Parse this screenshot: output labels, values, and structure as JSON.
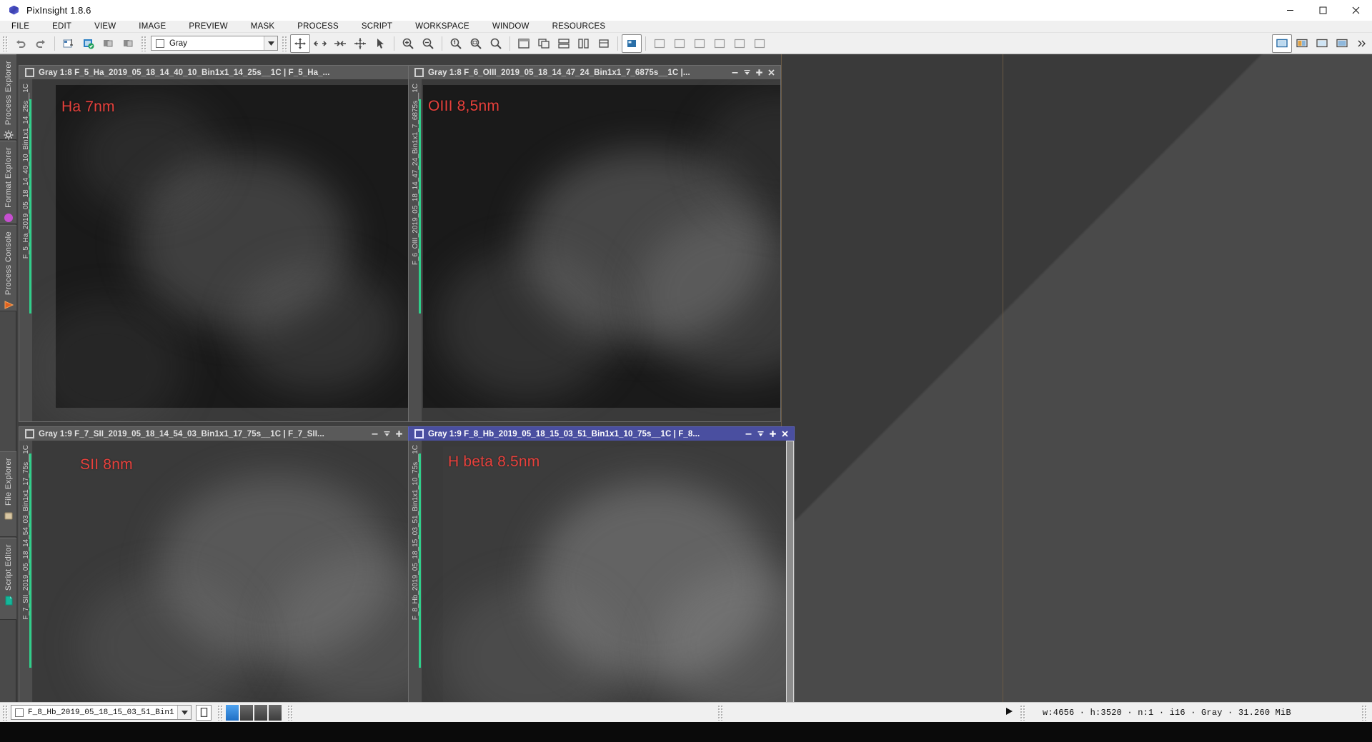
{
  "window": {
    "app_title": "PixInsight 1.8.6",
    "icon": "pixinsight-cube-icon",
    "controls": {
      "minimize": "minimize-icon",
      "maximize": "maximize-icon",
      "close": "close-icon"
    }
  },
  "menubar": {
    "items": [
      {
        "label": "FILE"
      },
      {
        "label": "EDIT"
      },
      {
        "label": "VIEW"
      },
      {
        "label": "IMAGE"
      },
      {
        "label": "PREVIEW"
      },
      {
        "label": "MASK"
      },
      {
        "label": "PROCESS"
      },
      {
        "label": "SCRIPT"
      },
      {
        "label": "WORKSPACE"
      },
      {
        "label": "WINDOW"
      },
      {
        "label": "RESOURCES"
      }
    ]
  },
  "toolbar": {
    "groups": [
      {
        "icons": [
          "undo-icon",
          "redo-icon"
        ]
      },
      {
        "icons": [
          "new-image-icon",
          "open-image-icon",
          "save-image-icon",
          "save-as-image-icon"
        ]
      }
    ],
    "color_space_combo": {
      "value": "Gray",
      "swatch": "gray-swatch-icon",
      "dropdown": "chevron-down-icon"
    },
    "nav_icons": [
      "move-icon",
      "expand-icon",
      "collapse-icon",
      "fit-icon",
      "pointer-icon"
    ],
    "zoom_icons": [
      "zoom-in-icon",
      "zoom-out-icon",
      "zoom-1to1-icon",
      "zoom-fit-icon"
    ],
    "window_icons": [
      "tile-window-icon",
      "cascade-window-icon",
      "tile-horizontal-icon",
      "tile-vertical-icon",
      "stack-window-icon"
    ],
    "readout_icons": [
      "readout-icon"
    ],
    "misc_icons": [
      "histogram-icon",
      "stf-icon",
      "mask-icon",
      "preview-icon",
      "annotate-icon",
      "grid-icon"
    ],
    "right_icons": [
      "screen-icon",
      "screen-transfer-icon",
      "monitor-icon",
      "display-icon"
    ],
    "overflow": "chevron-right-overflow-icon"
  },
  "left_dock": {
    "top_tabs": [
      {
        "label": "Process Explorer",
        "icon": "gear-icon",
        "icon_color": "#d8d8d8"
      },
      {
        "label": "Format Explorer",
        "icon": "circle-icon",
        "icon_color": "#c64fd0"
      },
      {
        "label": "Process Console",
        "icon": "triangle-play-icon",
        "icon_color": "#e0621f"
      }
    ],
    "bottom_tabs": [
      {
        "label": "File Explorer",
        "icon": "folder-icon",
        "icon_color": "#d8c7a3"
      },
      {
        "label": "Script Editor",
        "icon": "document-icon",
        "icon_color": "#15b79a"
      }
    ]
  },
  "image_windows": [
    {
      "id": "win-ha",
      "active": false,
      "title": "Gray 1:8 F_5_Ha_2019_05_18_14_40_10_Bin1x1_14_25s__1C | F_5_Ha_...",
      "side_label": "F_5_Ha_2019_05_18_14_40_10_Bin1x1_14_25s__1C",
      "overlay_label": "Ha 7nm",
      "overlay_color": "#e8413c",
      "titlebar_icon": "window-restore-icon",
      "buttons": [
        "minimize-icon",
        "shade-icon",
        "maximize-icon",
        "close-icon"
      ]
    },
    {
      "id": "win-oiii",
      "active": false,
      "title": "Gray 1:8 F_6_OIII_2019_05_18_14_47_24_Bin1x1_7_6875s__1C |...",
      "side_label": "F_6_OIII_2019_05_18_14_47_24_Bin1x1_7_6875s__1C",
      "overlay_label": "OIII 8,5nm",
      "overlay_color": "#e8413c",
      "titlebar_icon": "window-restore-icon",
      "buttons": [
        "minimize-icon",
        "shade-icon",
        "maximize-icon",
        "close-icon"
      ]
    },
    {
      "id": "win-sii",
      "active": false,
      "title": "Gray 1:9 F_7_SII_2019_05_18_14_54_03_Bin1x1_17_75s__1C | F_7_SII...",
      "side_label": "F_7_SII_2019_05_18_14_54_03_Bin1x1_17_75s__1C",
      "overlay_label": "SII 8nm",
      "overlay_color": "#e8413c",
      "titlebar_icon": "window-restore-icon",
      "buttons": [
        "minimize-icon",
        "shade-icon",
        "maximize-icon",
        "close-icon"
      ]
    },
    {
      "id": "win-hb",
      "active": true,
      "title": "Gray 1:9 F_8_Hb_2019_05_18_15_03_51_Bin1x1_10_75s__1C | F_8...",
      "side_label": "F_8_Hb_2019_05_18_15_03_51_Bin1x1_10_75s__1C",
      "overlay_label": "H beta 8.5nm",
      "overlay_color": "#e8413c",
      "titlebar_icon": "window-restore-icon",
      "buttons": [
        "minimize-icon",
        "shade-icon",
        "maximize-icon",
        "close-icon"
      ]
    }
  ],
  "statusbar": {
    "view_selector": {
      "value": "F_8_Hb_2019_05_18_15_03_51_Bin1",
      "swatch": "gray-swatch-icon",
      "dropdown": "chevron-down-icon"
    },
    "preview_button": "preview-toggle-icon",
    "channel_swatches": [
      {
        "name": "channel-swatch-blue",
        "color": "#2f86e8"
      },
      {
        "name": "channel-swatch-gray-1",
        "color": "#5a5a5a"
      },
      {
        "name": "channel-swatch-gray-2",
        "color": "#5a5a5a"
      },
      {
        "name": "channel-swatch-gray-3",
        "color": "#5a5a5a"
      }
    ],
    "play_icon": "play-icon",
    "image_info": "w:4656 · h:3520 · n:1 · i16 · Gray · 31.260 MiB"
  },
  "taskbar": {
    "clock": ""
  }
}
